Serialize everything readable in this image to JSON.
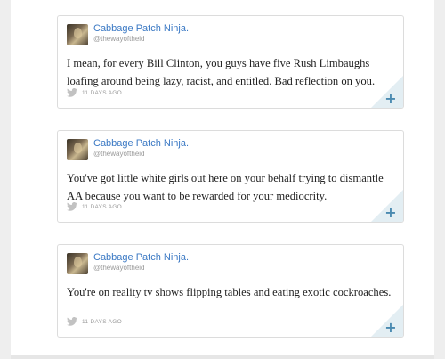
{
  "tweets": [
    {
      "name": "Cabbage Patch Ninja.",
      "handle": "@thewayoftheid",
      "text": "I mean, for every Bill Clinton, you guys have five Rush Limbaughs loafing around being lazy, racist, and entitled. Bad reflection on you.",
      "time": "11 DAYS AGO",
      "action": "+"
    },
    {
      "name": "Cabbage Patch Ninja.",
      "handle": "@thewayoftheid",
      "text": "You've got little white girls out here on your behalf trying to dismantle AA because you want to be rewarded for your mediocrity.",
      "time": "11 DAYS AGO",
      "action": "+"
    },
    {
      "name": "Cabbage Patch Ninja.",
      "handle": "@thewayoftheid",
      "text": "You're on reality tv shows flipping tables and eating exotic cockroaches.",
      "time": "11 DAYS AGO",
      "action": "+"
    }
  ],
  "icons": {
    "source": "twitter-bird-icon",
    "expand": "plus-icon"
  },
  "colors": {
    "name_link": "#3b79c4",
    "background": "#eeeeee",
    "card_border": "#dcdcdc",
    "corner": "#e3eef3"
  }
}
